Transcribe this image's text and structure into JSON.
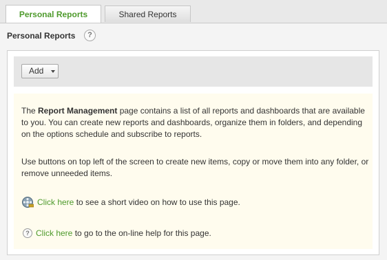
{
  "tabs": [
    {
      "label": "Personal Reports",
      "active": true
    },
    {
      "label": "Shared Reports",
      "active": false
    }
  ],
  "page": {
    "title": "Personal Reports",
    "help_icon": "question-icon",
    "help_glyph": "?"
  },
  "toolbar": {
    "add_label": "Add"
  },
  "info": {
    "p1_before": "The ",
    "p1_bold": "Report Management",
    "p1_after": " page contains a list of all reports and dashboards that are available to you. You can create new reports and dashboards, organize them in folders, and depending on the options schedule and subscribe to reports.",
    "p2": "Use buttons on top left of the screen to create new items, copy or move them into any folder, or remove unneeded items.",
    "video_link": "Click here",
    "video_text": " to see a short video on how to use this page.",
    "help_link": "Click here",
    "help_text": " to go to the on-line help for this page.",
    "help_glyph": "?"
  },
  "colors": {
    "link": "#4e9a2c",
    "info_bg": "#fffcee",
    "toolbar_bg": "#e6e6e6"
  }
}
